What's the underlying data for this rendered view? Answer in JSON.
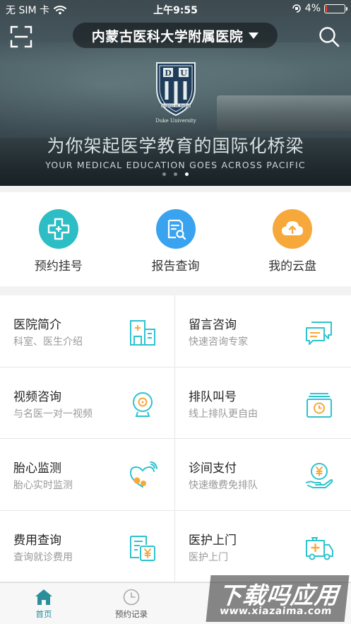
{
  "status_bar": {
    "carrier": "无 SIM 卡",
    "time": "上午9:55",
    "battery": "4%",
    "battery_level": 0.04
  },
  "header": {
    "hospital_name": "内蒙古医科大学附属医院"
  },
  "banner": {
    "crest_letters": [
      "D",
      "U"
    ],
    "crest_motto": "Eruditio et Religio",
    "crest_caption": "Duke University",
    "slogan_cn": "为你架起医学教育的国际化桥梁",
    "slogan_en": "YOUR MEDICAL EDUCATION GOES ACROSS PACIFIC",
    "slide_count": 3,
    "active_slide": 3
  },
  "quick_services": [
    {
      "label": "预约挂号",
      "icon": "plus-cross-icon",
      "color": "#2dbdc4"
    },
    {
      "label": "报告查询",
      "icon": "report-search-icon",
      "color": "#3aa3f0"
    },
    {
      "label": "我的云盘",
      "icon": "cloud-upload-icon",
      "color": "#f7a83b"
    }
  ],
  "services": [
    {
      "title": "医院简介",
      "subtitle": "科室、医生介绍",
      "icon": "building-icon"
    },
    {
      "title": "留言咨询",
      "subtitle": "快速咨询专家",
      "icon": "chat-bubbles-icon"
    },
    {
      "title": "视频咨询",
      "subtitle": "与名医一对一视频",
      "icon": "webcam-icon"
    },
    {
      "title": "排队叫号",
      "subtitle": "线上排队更自由",
      "icon": "queue-clock-icon"
    },
    {
      "title": "胎心监测",
      "subtitle": "胎心实时监测",
      "icon": "heart-signal-icon"
    },
    {
      "title": "诊间支付",
      "subtitle": "快速缴费免排队",
      "icon": "hand-coin-icon"
    },
    {
      "title": "费用查询",
      "subtitle": "查询就诊费用",
      "icon": "bill-icon"
    },
    {
      "title": "医护上门",
      "subtitle": "医护上门",
      "icon": "ambulance-icon"
    }
  ],
  "tabbar": [
    {
      "label": "首页",
      "icon": "home-icon",
      "active": true
    },
    {
      "label": "预约记录",
      "icon": "clock-icon",
      "active": false
    }
  ],
  "watermark": {
    "title": "下载吗应用",
    "url": "www.xiazaima.com"
  },
  "colors": {
    "accent": "#2dc3cf",
    "tab_active": "#2b8f9b"
  }
}
